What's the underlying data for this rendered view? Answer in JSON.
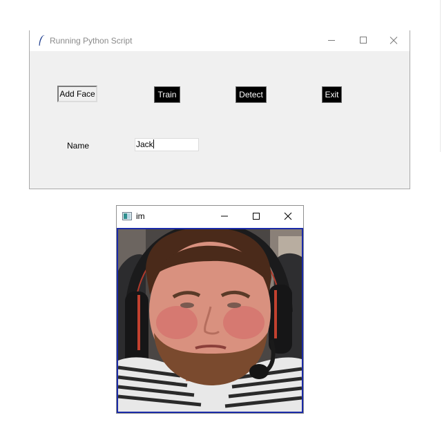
{
  "main_window": {
    "title": "Running Python Script",
    "buttons": {
      "add_face": "Add Face",
      "train": "Train",
      "detect": "Detect",
      "exit": "Exit"
    },
    "name_label": "Name",
    "name_value": "Jack"
  },
  "image_window": {
    "title": "im"
  },
  "icons": {
    "app_icon": "feather-icon",
    "minimize": "minimize-icon",
    "maximize": "maximize-icon",
    "close": "close-icon",
    "image_window_icon": "opencv-window-icon"
  },
  "colors": {
    "window_bg": "#f0f0f0",
    "dark_button_bg": "#000000",
    "image_border": "#1a2aa8"
  }
}
